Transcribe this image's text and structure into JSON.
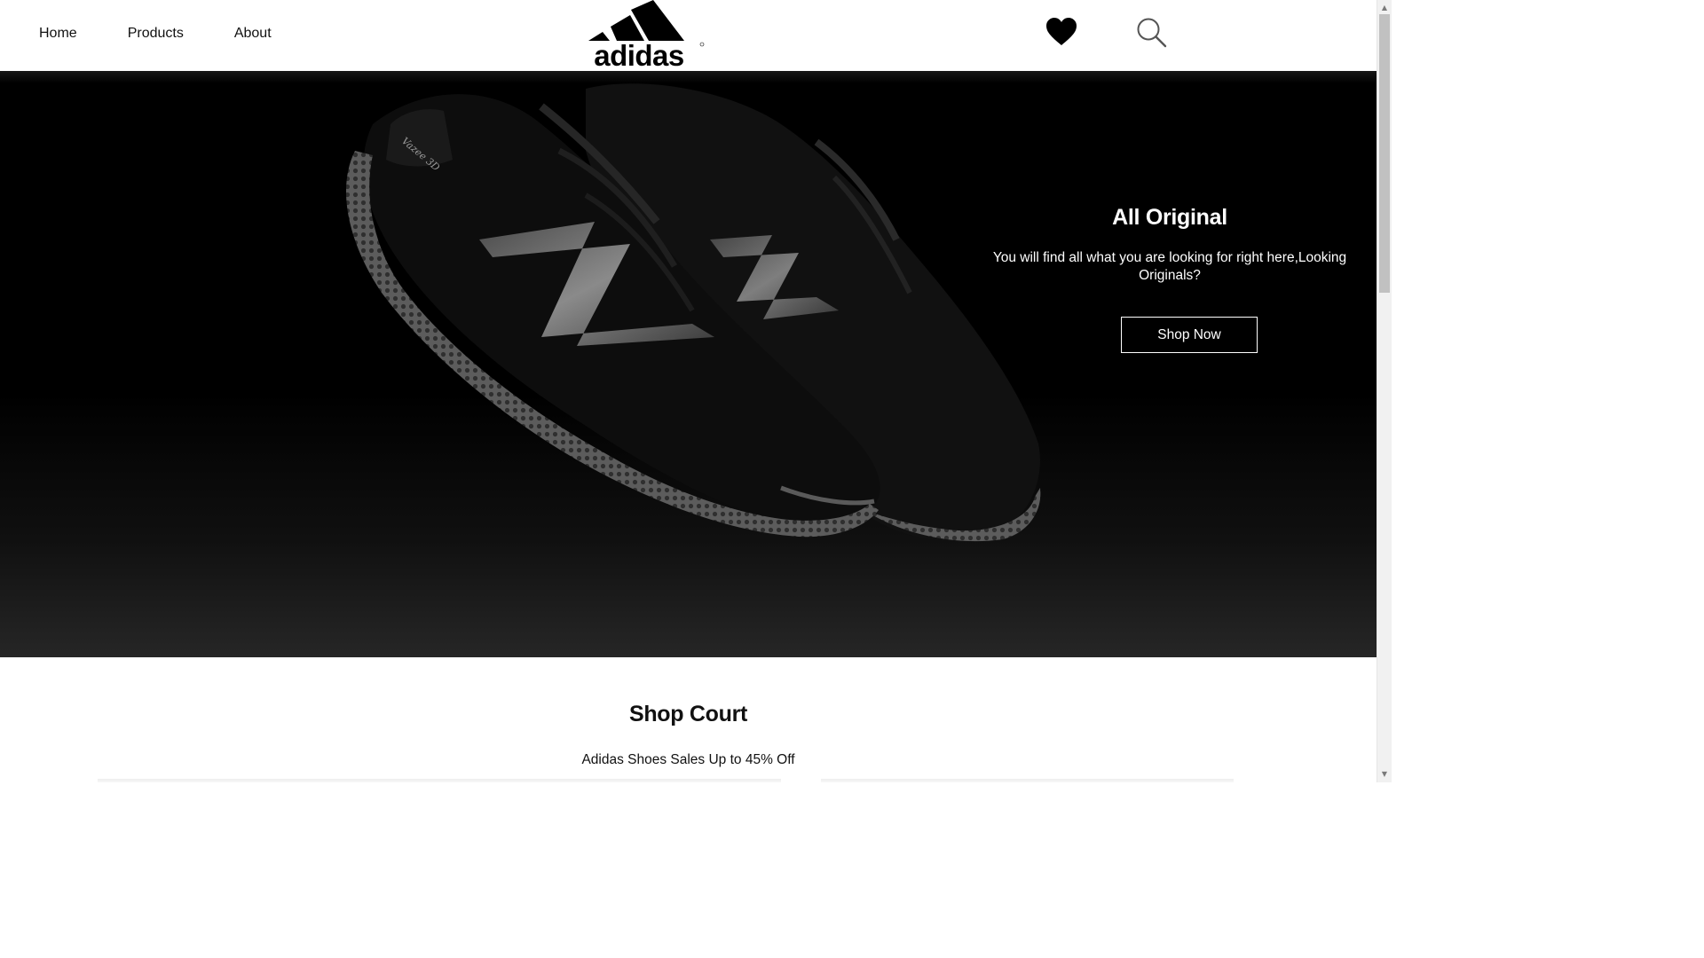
{
  "nav": {
    "links": [
      "Home",
      "Products",
      "About"
    ],
    "logo_text": "adidas",
    "favorites_icon": "heart-icon",
    "search_icon": "search-icon"
  },
  "hero": {
    "title": "All Original",
    "description": "You will find all what you are looking for right here,Looking Originals?",
    "button_label": "Shop Now",
    "image": "black-sneakers-pair"
  },
  "section": {
    "title": "Shop Court",
    "subtitle": "Adidas Shoes Sales Up to 45% Off"
  },
  "colors": {
    "background": "#ffffff",
    "hero_background": "#000000",
    "text": "#111111",
    "hero_text": "#ffffff"
  }
}
